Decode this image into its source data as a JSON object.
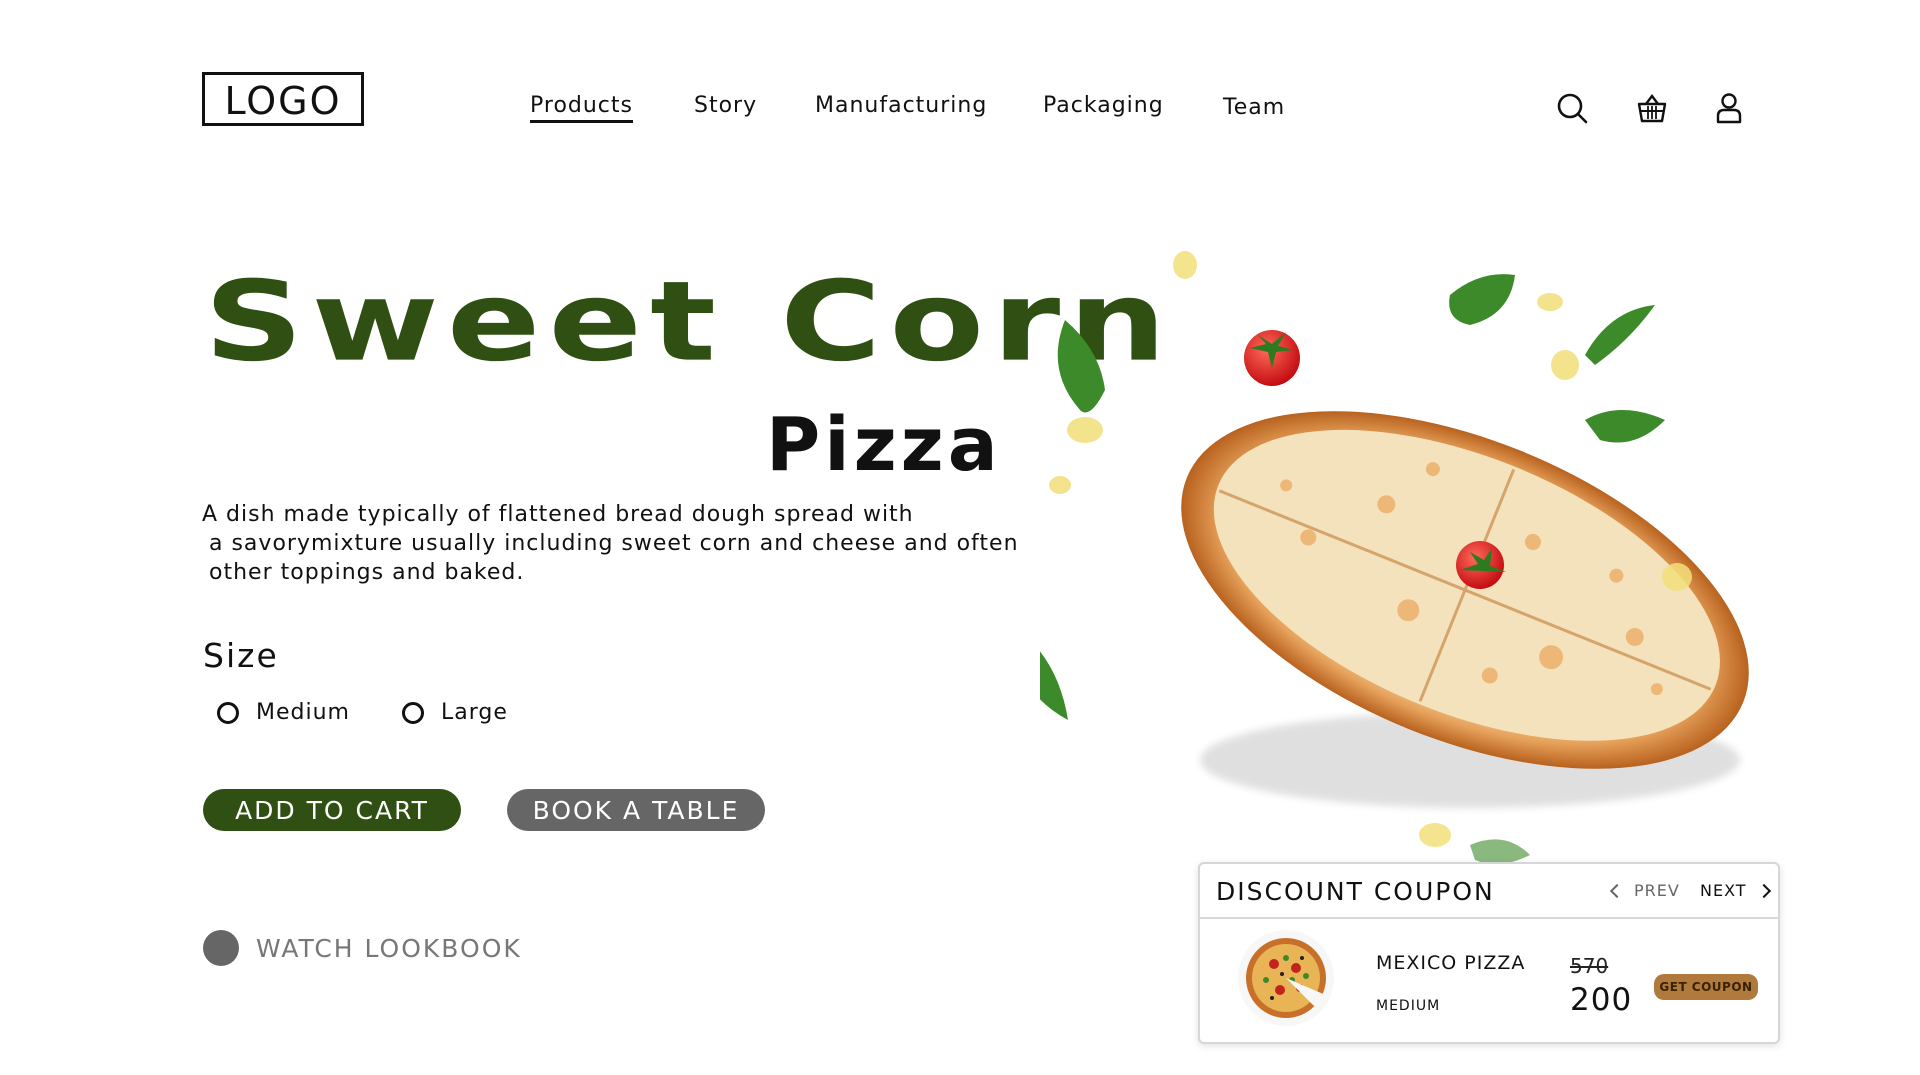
{
  "header": {
    "logo": "LOGO",
    "nav": [
      "Products",
      "Story",
      "Manufacturing",
      "Packaging",
      "Team"
    ],
    "active_nav": "Products",
    "icons": [
      "search-icon",
      "basket-icon",
      "user-icon"
    ]
  },
  "hero": {
    "title": "Sweet Corn",
    "subtitle": "Pizza",
    "description_lines": [
      "A dish made typically of flattened bread dough spread with",
      "a savorymixture usually including sweet corn and cheese and often",
      "other toppings and baked."
    ],
    "size_label": "Size",
    "size_options": [
      "Medium",
      "Large"
    ],
    "add_to_cart": "ADD TO CART",
    "book_table": "BOOK A TABLE",
    "watch_lookbook": "WATCH LOOKBOOK"
  },
  "coupon": {
    "title": "DISCOUNT COUPON",
    "prev": "PREV",
    "next": "NEXT",
    "item_name": "MEXICO PIZZA",
    "item_size": "MEDIUM",
    "old_price": "570",
    "new_price": "200",
    "button": "GET COUPON"
  },
  "colors": {
    "brand_green": "#2f5012",
    "secondary_gray": "#666666",
    "coupon_button": "#b07a3c"
  }
}
